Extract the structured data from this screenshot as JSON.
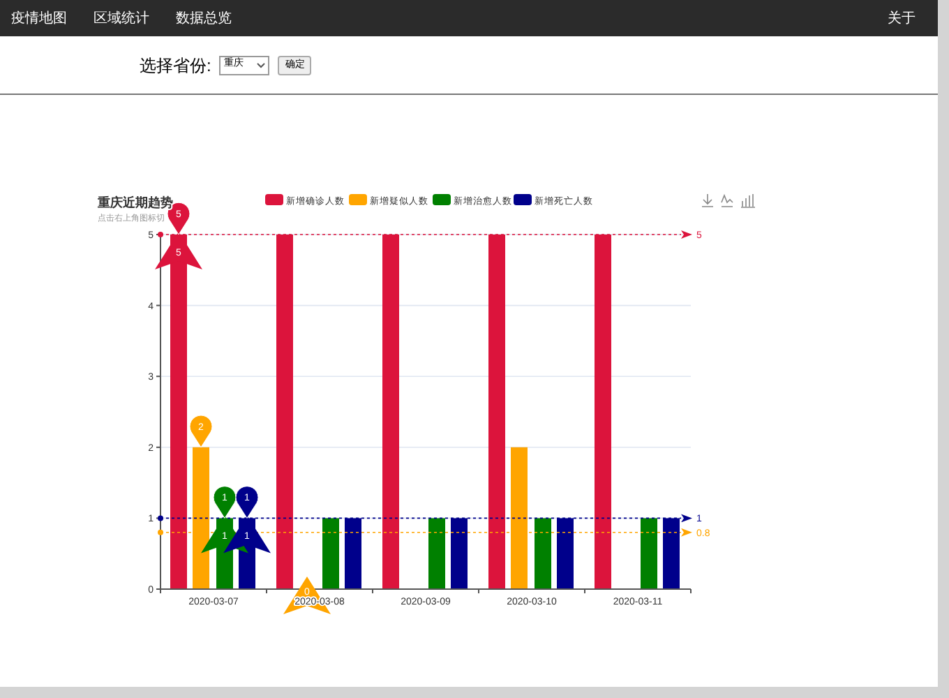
{
  "nav": {
    "items": [
      {
        "label": "疫情地图"
      },
      {
        "label": "区域统计"
      },
      {
        "label": "数据总览"
      }
    ],
    "right": "关于"
  },
  "form": {
    "label": "选择省份:",
    "select": "重庆",
    "button": "确定"
  },
  "chart": {
    "title": "重庆近期趋势",
    "subtitle": "点击右上角图标切",
    "chart_data": {
      "type": "bar",
      "categories": [
        "2020-03-07",
        "2020-03-08",
        "2020-03-09",
        "2020-03-10",
        "2020-03-11"
      ],
      "yticks": [
        0,
        1,
        2,
        3,
        4,
        5
      ],
      "ylim": [
        0,
        5
      ],
      "grid": true,
      "legend": true,
      "series": [
        {
          "name": "新增确诊人数",
          "color": "#dc143c",
          "values": [
            5,
            5,
            5,
            5,
            5
          ]
        },
        {
          "name": "新增疑似人数",
          "color": "#ffa500",
          "values": [
            2,
            0,
            0,
            2,
            0
          ]
        },
        {
          "name": "新增治愈人数",
          "color": "#008000",
          "values": [
            1,
            1,
            1,
            1,
            1
          ]
        },
        {
          "name": "新增死亡人数",
          "color": "#00008b",
          "values": [
            1,
            1,
            1,
            1,
            1
          ]
        }
      ],
      "ref_lines": [
        {
          "axis": "y",
          "value": 5,
          "label": "5",
          "color": "#dc143c"
        },
        {
          "axis": "y",
          "value": 1,
          "label": "1",
          "color": "#00008b"
        },
        {
          "axis": "y",
          "value": 0.8,
          "label": "0.8",
          "color": "#ffa500"
        }
      ]
    },
    "mark_points": [
      {
        "min": "5",
        "max": "5"
      },
      {
        "min": "0",
        "max": "2"
      },
      {
        "min": "1",
        "max": "1"
      },
      {
        "min": "1",
        "max": "1"
      }
    ]
  }
}
